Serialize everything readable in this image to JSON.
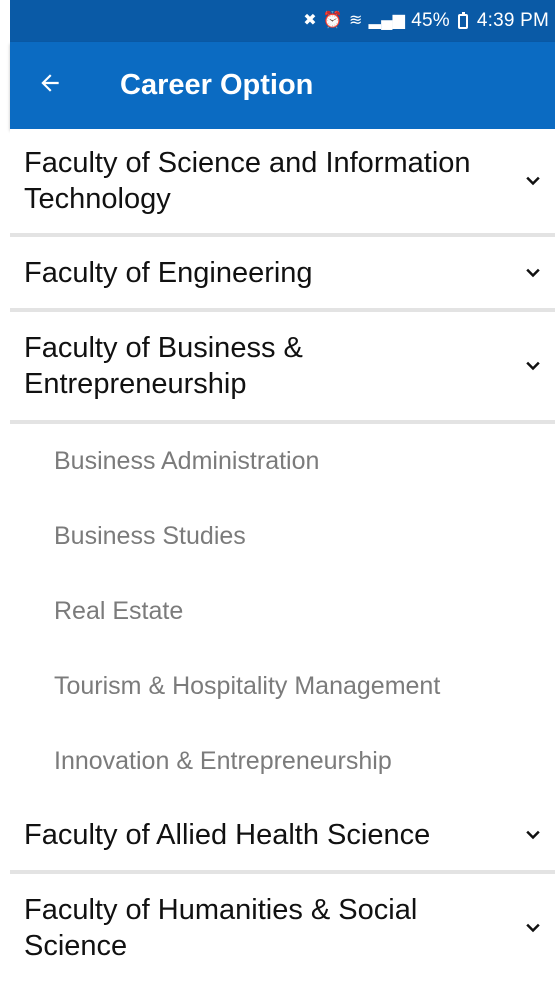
{
  "status_bar": {
    "battery": "45%",
    "time": "4:39 PM",
    "icons": [
      "mute-vibrate-icon",
      "alarm-icon",
      "wifi-icon",
      "signal-icon",
      "battery-icon"
    ]
  },
  "app_bar": {
    "title": "Career Option",
    "back_icon": "arrow-left-icon"
  },
  "faculties": [
    {
      "label": "Faculty of Science and Information Technology",
      "expanded": false
    },
    {
      "label": "Faculty of Engineering",
      "expanded": false
    },
    {
      "label": "Faculty of Business & Entrepreneurship",
      "expanded": true,
      "programs": [
        "Business Administration",
        "Business Studies",
        "Real Estate",
        "Tourism & Hospitality Management",
        "Innovation & Entrepreneurship"
      ]
    },
    {
      "label": "Faculty of Allied Health Science",
      "expanded": false
    },
    {
      "label": "Faculty of Humanities & Social Science",
      "expanded": false
    }
  ],
  "colors": {
    "status_bar": "#0a5aa6",
    "app_bar": "#0b6bc2",
    "sub_item_text": "#7b7b7b"
  }
}
